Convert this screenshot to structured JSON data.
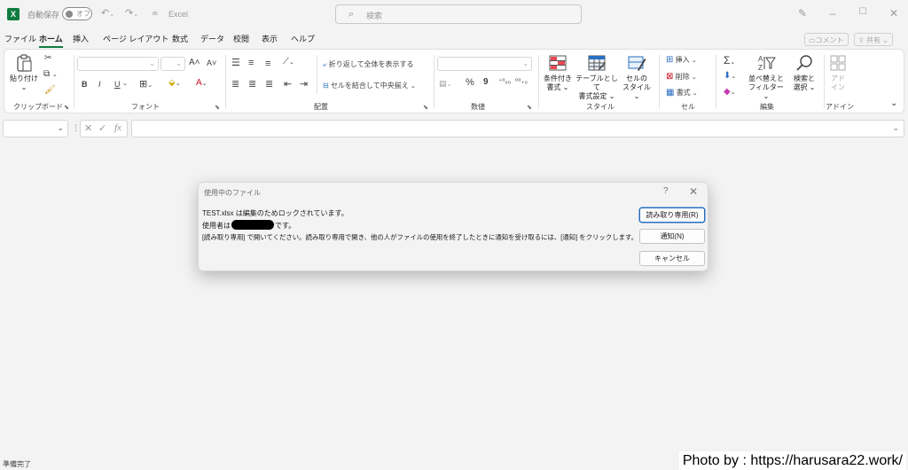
{
  "titlebar": {
    "app_icon": "X",
    "autosave_label": "自動保存",
    "autosave_state": "オフ",
    "document_name": "Excel",
    "search_placeholder": "検索",
    "icons": [
      "excel-app-icon",
      "undo-icon",
      "redo-icon",
      "customize-qat-icon",
      "search-icon",
      "pen-icon",
      "minimize-icon",
      "maximize-icon",
      "close-icon"
    ]
  },
  "menu": {
    "items": [
      "ファイル",
      "ホーム",
      "挿入",
      "ページ レイアウト",
      "数式",
      "データ",
      "校閲",
      "表示",
      "ヘルプ"
    ],
    "active": "ホーム",
    "comment_button": "コメント",
    "share_button": "共有"
  },
  "ribbon": {
    "clipboard": {
      "label": "クリップボード",
      "paste": "貼り付け"
    },
    "font": {
      "label": "フォント",
      "bold": "B",
      "italic": "I",
      "underline": "U",
      "grow": "A",
      "shrink": "A"
    },
    "alignment": {
      "label": "配置",
      "wrap_text": "折り返して全体を表示する",
      "merge_center": "セルを結合して中央揃え"
    },
    "number": {
      "label": "数値",
      "percent": "%",
      "comma": "9"
    },
    "styles": {
      "label": "スタイル",
      "conditional_1": "条件付き",
      "conditional_2": "書式",
      "table_1": "テーブルとして",
      "table_2": "書式設定",
      "cell_1": "セルの",
      "cell_2": "スタイル"
    },
    "cells": {
      "label": "セル",
      "insert": "挿入",
      "delete": "削除",
      "format": "書式"
    },
    "editing": {
      "label": "編集",
      "sort_1": "並べ替えと",
      "sort_2": "フィルター",
      "find_1": "検索と",
      "find_2": "選択"
    },
    "addins": {
      "label": "アドイン",
      "addin_1": "アド",
      "addin_2": "イン"
    }
  },
  "formula_bar": {
    "fx": "fx"
  },
  "dialog": {
    "title": "使用中のファイル",
    "help": "?",
    "line1": "TEST.xlsx は編集のためロックされています。",
    "line2_prefix": "使用者は",
    "line2_suffix": "です。",
    "line3": "[読み取り専用] で開いてください。読み取り専用で開き、他の人がファイルの使用を終了したときに通知を受け取るには、[通知] をクリックします。",
    "buttons": {
      "read_only": "読み取り専用(R)",
      "notify": "通知(N)",
      "cancel": "キャンセル"
    }
  },
  "status": {
    "text": "準備完了"
  },
  "watermark": "Photo by : https://harusara22.work/",
  "colors": {
    "excel_green": "#107c41",
    "focus_blue": "#2a6fc2"
  }
}
